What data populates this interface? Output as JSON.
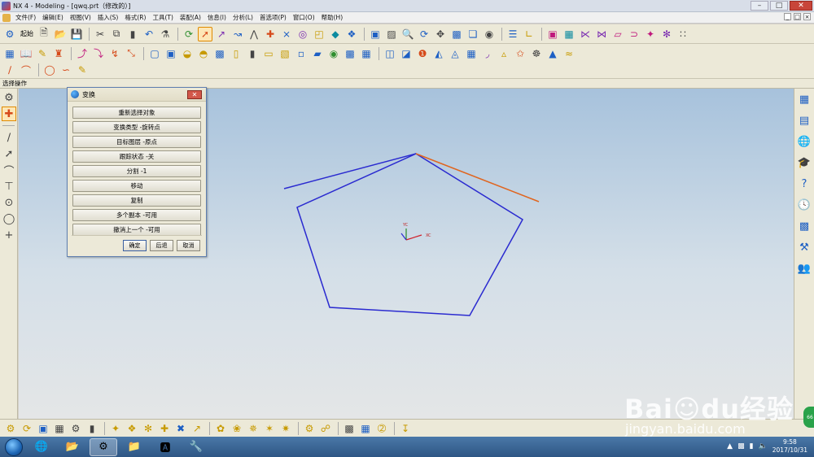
{
  "window": {
    "title": "NX 4 - Modeling - [qwq.prt（修改的）]"
  },
  "menu": [
    "文件(F)",
    "编辑(E)",
    "视图(V)",
    "插入(S)",
    "格式(R)",
    "工具(T)",
    "装配(A)",
    "信息(I)",
    "分析(L)",
    "首选项(P)",
    "窗口(O)",
    "帮助(H)"
  ],
  "toolbar": {
    "start_label": "起始"
  },
  "status": {
    "prompt": "选择操作"
  },
  "dialog": {
    "title": "变换",
    "buttons": [
      "重新选择对象",
      "变换类型 -旋转点",
      "目标图层 -原点",
      "跟踪状态 -关",
      "分割 -1",
      "移动",
      "复制",
      "多个副本 -可用",
      "撤消上一个 -可用"
    ],
    "ok": "确定",
    "back": "后退",
    "cancel": "取消"
  },
  "axes": {
    "yc": "YC",
    "xc": "XC"
  },
  "taskbar": {
    "time": "9:58",
    "date": "2017/10/31"
  },
  "watermark": {
    "brand": "Bai☺du经验",
    "url": "jingyan.baidu.com"
  },
  "badge": "66",
  "colors": {
    "pentagon": "#2a2ad0",
    "selected_edge": "#e0651f",
    "viewport_top": "#a7c2dc",
    "viewport_bottom": "#e4e6e7"
  },
  "icons": {
    "toolbar_row1": [
      "start-icon",
      "new-file-icon",
      "open-file-icon",
      "save-icon",
      "cut-icon",
      "copy-icon",
      "paste-icon",
      "undo-icon",
      "selection-filter-icon",
      "snap-icon",
      "select-curve-icon",
      "select-point-icon",
      "endpoint-icon",
      "midpoint-icon",
      "control-point-icon",
      "intersection-icon",
      "center-icon",
      "quadrant-icon",
      "existing-point-icon",
      "point-on-curve-icon",
      "fit-icon",
      "zoom-window-icon",
      "zoom-icon",
      "rotate-icon",
      "pan-icon",
      "render-icon",
      "view-orientation-icon",
      "shaded-icon",
      "layer-icon",
      "wcs-icon",
      "sketch-icon",
      "datum-icon",
      "extrude-icon",
      "revolve-icon",
      "block-icon",
      "cylinder-icon",
      "sphere-icon",
      "point-icon",
      "coordinate-icon"
    ],
    "toolbar_row2": [
      "assembly-icon",
      "book-icon",
      "drafting-icon",
      "measure-icon",
      "edge-blend-icon",
      "chamfer-icon",
      "trim-icon",
      "unite-icon",
      "subtract-icon",
      "intersect-icon",
      "shell-icon",
      "hole-icon",
      "boss-icon",
      "pocket-icon",
      "pad-icon",
      "slot-icon",
      "groove-icon",
      "feature-icon",
      "sweep-icon",
      "offset-icon",
      "scale-icon",
      "pattern-icon",
      "mirror-icon",
      "face-icon",
      "thicken-icon",
      "draft-icon",
      "surface-icon",
      "mesh-icon",
      "bridge-icon",
      "curve-icon",
      "spline-icon",
      "helix-icon",
      "text-icon",
      "wave-icon",
      "analysis-icon",
      "mold-icon"
    ],
    "toolbar_row3": [
      "line-icon",
      "arc-icon",
      "circle-icon",
      "spline-tool-icon",
      "sketch-tool-icon"
    ]
  }
}
